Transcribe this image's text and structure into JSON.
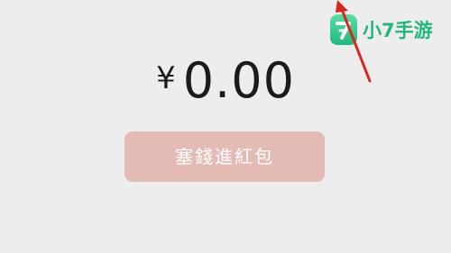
{
  "amount": {
    "currency": "¥",
    "value": "0.00"
  },
  "send_button": {
    "label": "塞錢進紅包"
  },
  "watermark": {
    "text": "小7手游"
  },
  "colors": {
    "background": "#ededed",
    "button": "#e3bab4",
    "watermark": "#21b77c",
    "arrow": "#d8261f"
  }
}
